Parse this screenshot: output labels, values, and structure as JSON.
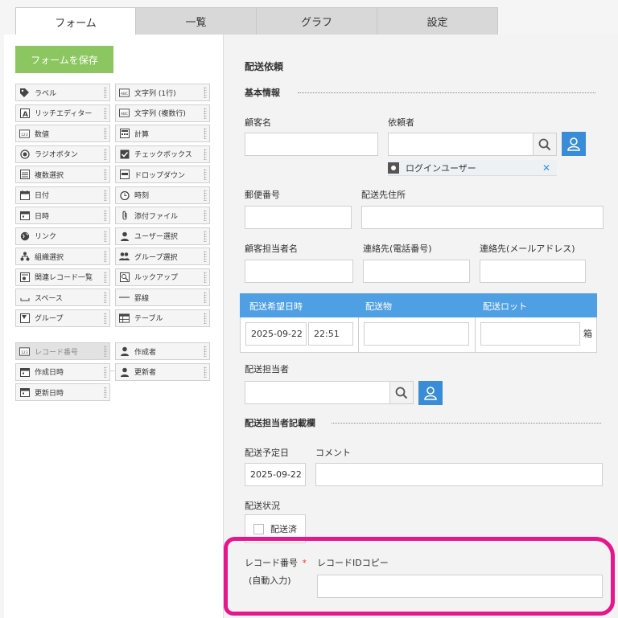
{
  "tabs": [
    {
      "label": "フォーム",
      "active": true
    },
    {
      "label": "一覧",
      "active": false
    },
    {
      "label": "グラフ",
      "active": false
    },
    {
      "label": "設定",
      "active": false
    }
  ],
  "save_button": "フォームを保存",
  "palette": [
    {
      "label": "ラベル",
      "icon": "tag-icon"
    },
    {
      "label": "文字列 (1行)",
      "icon": "text-line-icon"
    },
    {
      "label": "リッチエディター",
      "icon": "rich-editor-icon"
    },
    {
      "label": "文字列 (複数行)",
      "icon": "text-multiline-icon"
    },
    {
      "label": "数値",
      "icon": "number-icon"
    },
    {
      "label": "計算",
      "icon": "calculator-icon"
    },
    {
      "label": "ラジオボタン",
      "icon": "radio-icon"
    },
    {
      "label": "チェックボックス",
      "icon": "checkbox-icon"
    },
    {
      "label": "複数選択",
      "icon": "multi-select-icon"
    },
    {
      "label": "ドロップダウン",
      "icon": "dropdown-icon"
    },
    {
      "label": "日付",
      "icon": "calendar-icon"
    },
    {
      "label": "時刻",
      "icon": "clock-icon"
    },
    {
      "label": "日時",
      "icon": "datetime-icon"
    },
    {
      "label": "添付ファイル",
      "icon": "paperclip-icon"
    },
    {
      "label": "リンク",
      "icon": "globe-icon"
    },
    {
      "label": "ユーザー選択",
      "icon": "user-icon"
    },
    {
      "label": "組織選択",
      "icon": "org-icon"
    },
    {
      "label": "グループ選択",
      "icon": "group-icon"
    },
    {
      "label": "関連レコード一覧",
      "icon": "related-records-icon"
    },
    {
      "label": "ルックアップ",
      "icon": "lookup-icon"
    },
    {
      "label": "スペース",
      "icon": "space-icon"
    },
    {
      "label": "罫線",
      "icon": "line-icon"
    },
    {
      "label": "グループ",
      "icon": "group-folder-icon"
    },
    {
      "label": "テーブル",
      "icon": "table-icon"
    }
  ],
  "system_fields": [
    {
      "label": "レコード番号",
      "icon": "number-icon",
      "disabled": true
    },
    {
      "label": "作成者",
      "icon": "user-icon",
      "disabled": false
    },
    {
      "label": "作成日時",
      "icon": "datetime-icon",
      "disabled": false
    },
    {
      "label": "更新者",
      "icon": "user-icon",
      "disabled": false
    },
    {
      "label": "更新日時",
      "icon": "datetime-icon",
      "disabled": false
    }
  ],
  "form": {
    "title": "配送依頼",
    "section_basic": "基本情報",
    "customer_name": "顧客名",
    "requester": "依頼者",
    "login_user": "ログインユーザー",
    "postal_code": "郵便番号",
    "address": "配送先住所",
    "contact_person": "顧客担当者名",
    "phone": "連絡先(電話番号)",
    "email": "連絡先(メールアドレス)",
    "table": {
      "col1": "配送希望日時",
      "col2": "配送物",
      "col3": "配送ロット",
      "date": "2025-09-22",
      "time": "22:51",
      "unit": "箱"
    },
    "staff": "配送担当者",
    "section_staff": "配送担当者記載欄",
    "scheduled_date": "配送予定日",
    "scheduled_value": "2025-09-22",
    "comment": "コメント",
    "status": "配送状況",
    "status_option": "配送済",
    "record_number": "レコード番号",
    "required_mark": "*",
    "auto_input": "(自動入力)",
    "record_id_copy": "レコードIDコピー"
  }
}
